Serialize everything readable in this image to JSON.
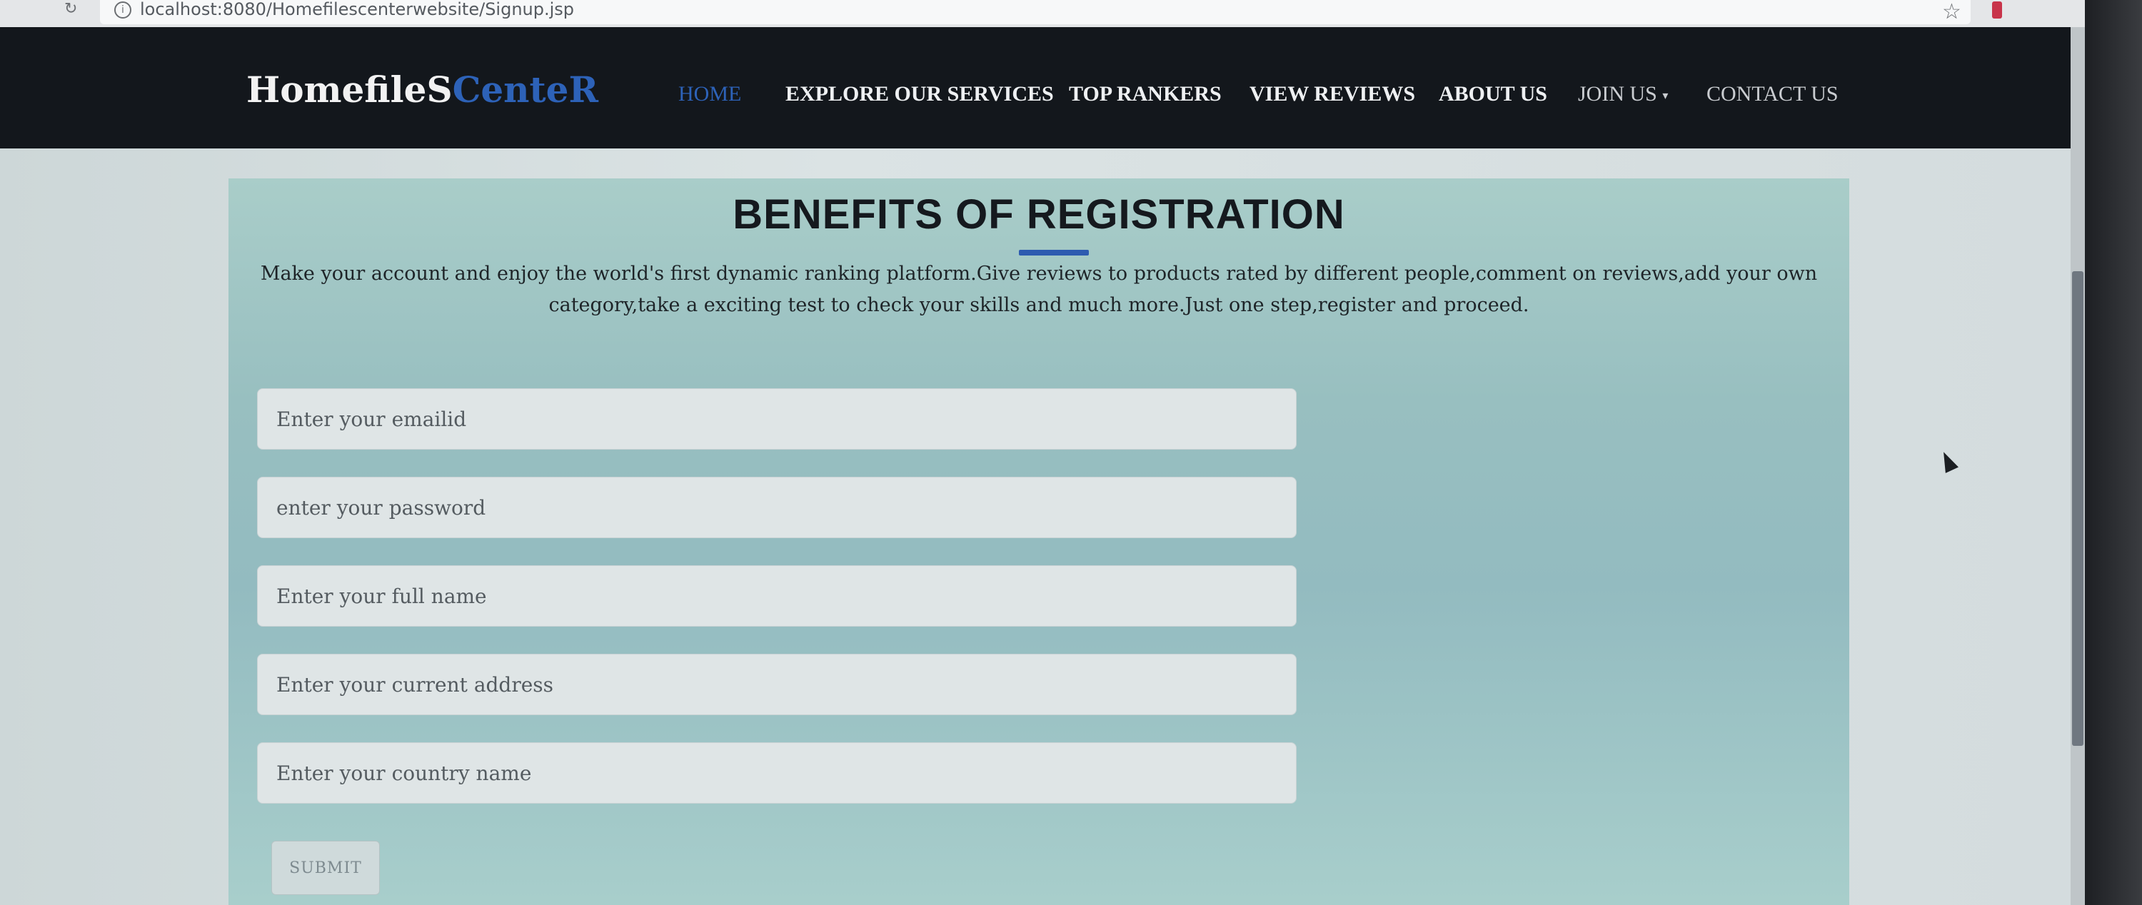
{
  "browser": {
    "url": "localhost:8080/Homefilescenterwebsite/Signup.jsp",
    "reload_icon": "reload-icon",
    "info_icon": "info-icon",
    "bookmark_icon": "star-icon"
  },
  "navbar": {
    "brand_main": "HomefileS",
    "brand_accent": "CenteR",
    "items": [
      {
        "label": "HOME",
        "active": true
      },
      {
        "label": "EXPLORE OUR SERVICES"
      },
      {
        "label": "TOP RANKERS"
      },
      {
        "label": "VIEW REVIEWS"
      },
      {
        "label": "ABOUT US"
      },
      {
        "label": "JOIN US"
      },
      {
        "label": "CONTACT US"
      }
    ],
    "join_caret": "▾"
  },
  "panel": {
    "title": "BENEFITS OF REGISTRATION",
    "description": "Make your account and enjoy the world's first dynamic ranking platform.Give reviews to products rated by different people,comment on reviews,add your own category,take a exciting test to check your skills and much more.Just one step,register and proceed."
  },
  "form": {
    "email_placeholder": "Enter your emailid",
    "password_placeholder": "enter your password",
    "name_placeholder": "Enter your full name",
    "address_placeholder": "Enter your current address",
    "country_placeholder": "Enter your country name",
    "submit_label": "SUBMIT"
  },
  "colors": {
    "navbar_bg": "#13171c",
    "accent": "#2d62b8",
    "panel_bg": "#98bfc0"
  }
}
